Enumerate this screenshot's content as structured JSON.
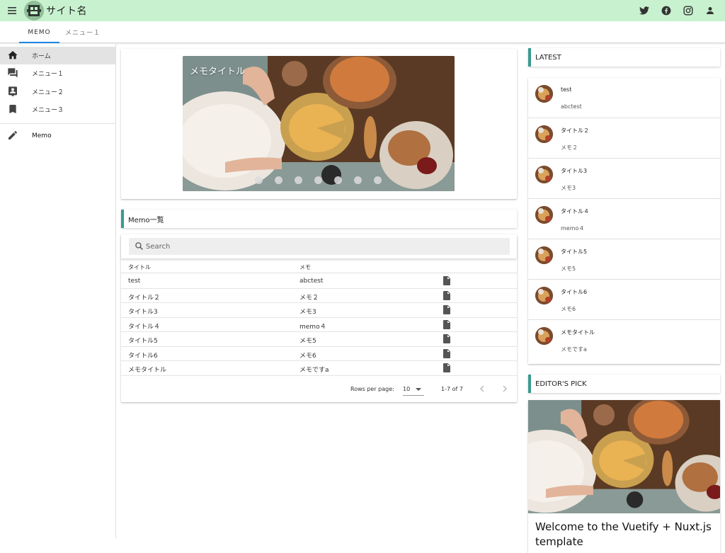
{
  "appbar": {
    "site_name": "サイト名",
    "icons": [
      "menu-icon",
      "logo",
      "twitter-icon",
      "facebook-icon",
      "instagram-icon",
      "account-icon"
    ]
  },
  "tabs": [
    {
      "label": "MEMO",
      "active": true
    },
    {
      "label": "メニュー１",
      "active": false
    }
  ],
  "sidebar": {
    "items": [
      {
        "label": "ホーム",
        "icon": "home-icon",
        "active": true
      },
      {
        "label": "メニュー１",
        "icon": "forum-icon"
      },
      {
        "label": "メニュー２",
        "icon": "account-box-icon"
      },
      {
        "label": "メニュー３",
        "icon": "bookmark-icon"
      },
      {
        "label": "Memo",
        "icon": "pencil-icon"
      }
    ]
  },
  "carousel": {
    "title": "メモタイトル",
    "slide_count": 7,
    "active_index": 6
  },
  "memo_list": {
    "heading": "Memo一覧",
    "search_placeholder": "Search",
    "columns": [
      "タイトル",
      "メモ"
    ],
    "rows": [
      {
        "title": "test",
        "memo": "abctest"
      },
      {
        "title": "タイトル２",
        "memo": "メモ２"
      },
      {
        "title": "タイトル3",
        "memo": "メモ3"
      },
      {
        "title": "タイトル４",
        "memo": "memo４"
      },
      {
        "title": "タイトル5",
        "memo": "メモ5"
      },
      {
        "title": "タイトル6",
        "memo": "メモ6"
      },
      {
        "title": "メモタイトル",
        "memo": "メモですa"
      }
    ],
    "footer": {
      "rows_per_page_label": "Rows per page:",
      "rows_per_page_value": "10",
      "page_info": "1-7 of 7"
    }
  },
  "latest": {
    "heading": "LATEST",
    "items": [
      {
        "title": "test",
        "sub": "abctest"
      },
      {
        "title": "タイトル２",
        "sub": "メモ２"
      },
      {
        "title": "タイトル3",
        "sub": "メモ3"
      },
      {
        "title": "タイトル４",
        "sub": "memo４"
      },
      {
        "title": "タイトル5",
        "sub": "メモ5"
      },
      {
        "title": "タイトル6",
        "sub": "メモ6"
      },
      {
        "title": "メモタイトル",
        "sub": "メモですa"
      }
    ]
  },
  "editors_pick": {
    "heading": "EDITOR'S PICK",
    "title": "Welcome to the Vuetify + Nuxt.js template"
  },
  "colors": {
    "appbar": "#c8f2cf",
    "accent_border": "#3a9b8f",
    "tab_indicator": "#1e88e5"
  }
}
